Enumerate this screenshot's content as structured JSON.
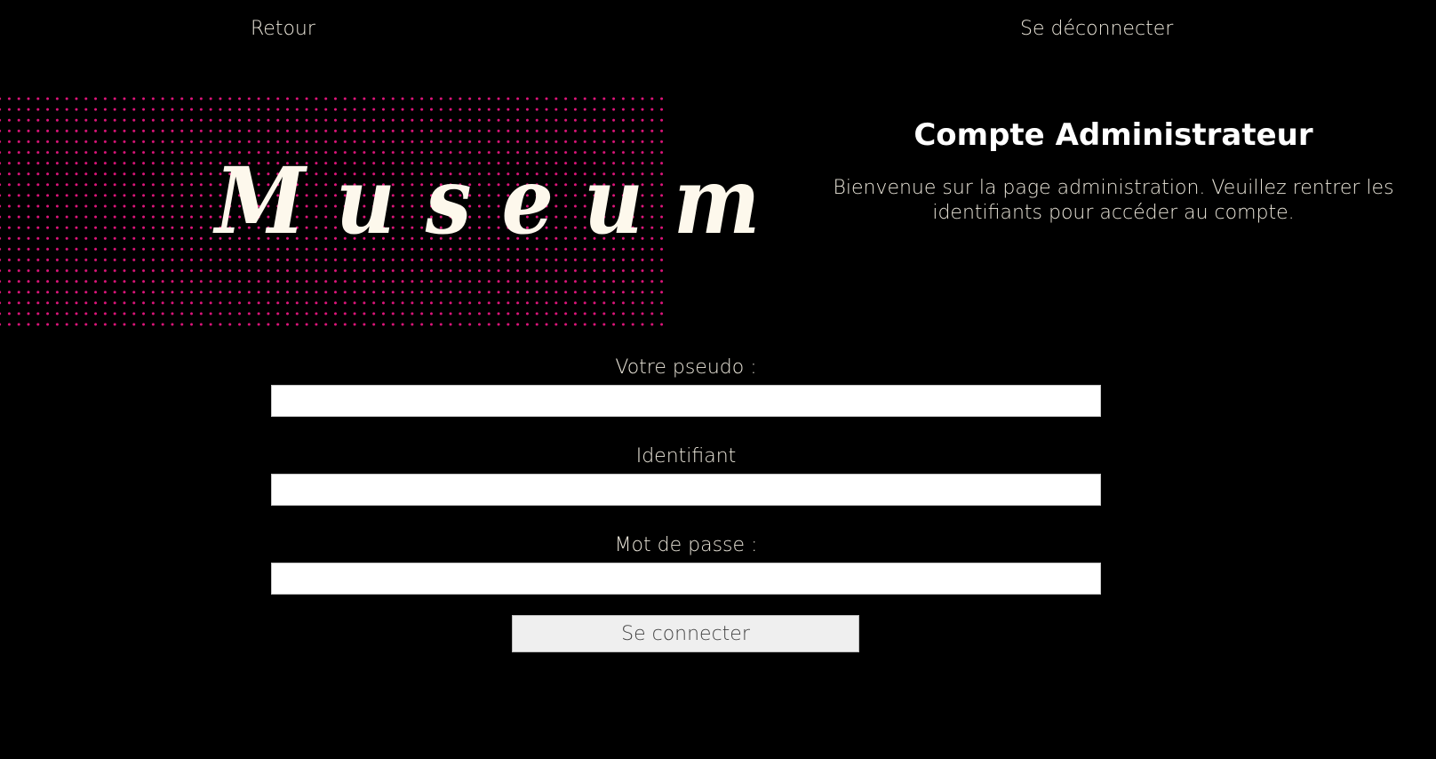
{
  "nav": {
    "back_label": "Retour",
    "logout_label": "Se déconnecter"
  },
  "hero": {
    "title": "Museum"
  },
  "intro": {
    "heading": "Compte Administrateur",
    "text": "Bienvenue sur la page administration. Veuillez rentrer les identifiants pour accéder au compte."
  },
  "form": {
    "pseudo": {
      "label": "Votre pseudo :",
      "value": ""
    },
    "identifiant": {
      "label": "Identifiant",
      "value": ""
    },
    "password": {
      "label": "Mot de passe :",
      "value": ""
    },
    "submit_label": "Se connecter"
  },
  "colors": {
    "background": "#000000",
    "text": "#e9e4d8",
    "dot_pattern": "#e0157c",
    "title_fill": "#fdf8ec"
  }
}
